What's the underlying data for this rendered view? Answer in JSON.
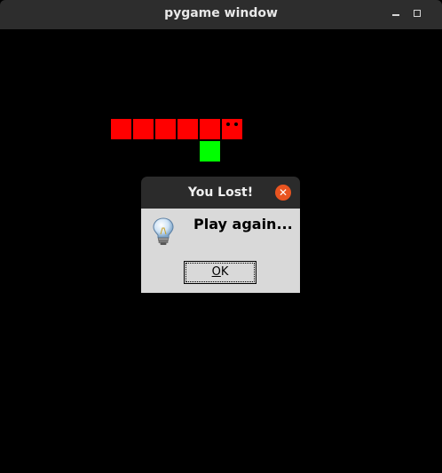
{
  "window": {
    "title": "pygame window"
  },
  "game": {
    "snake_color": "#ff0000",
    "food_color": "#00ff00",
    "background_color": "#000000",
    "snake_length": 6,
    "food_count": 1
  },
  "dialog": {
    "title": "You Lost!",
    "message": "Play again...",
    "icon": "lightbulb-icon",
    "ok_label": "OK",
    "ok_mnemonic": "O",
    "ok_rest": "K",
    "close_icon": "close-icon",
    "close_color": "#e95420"
  }
}
